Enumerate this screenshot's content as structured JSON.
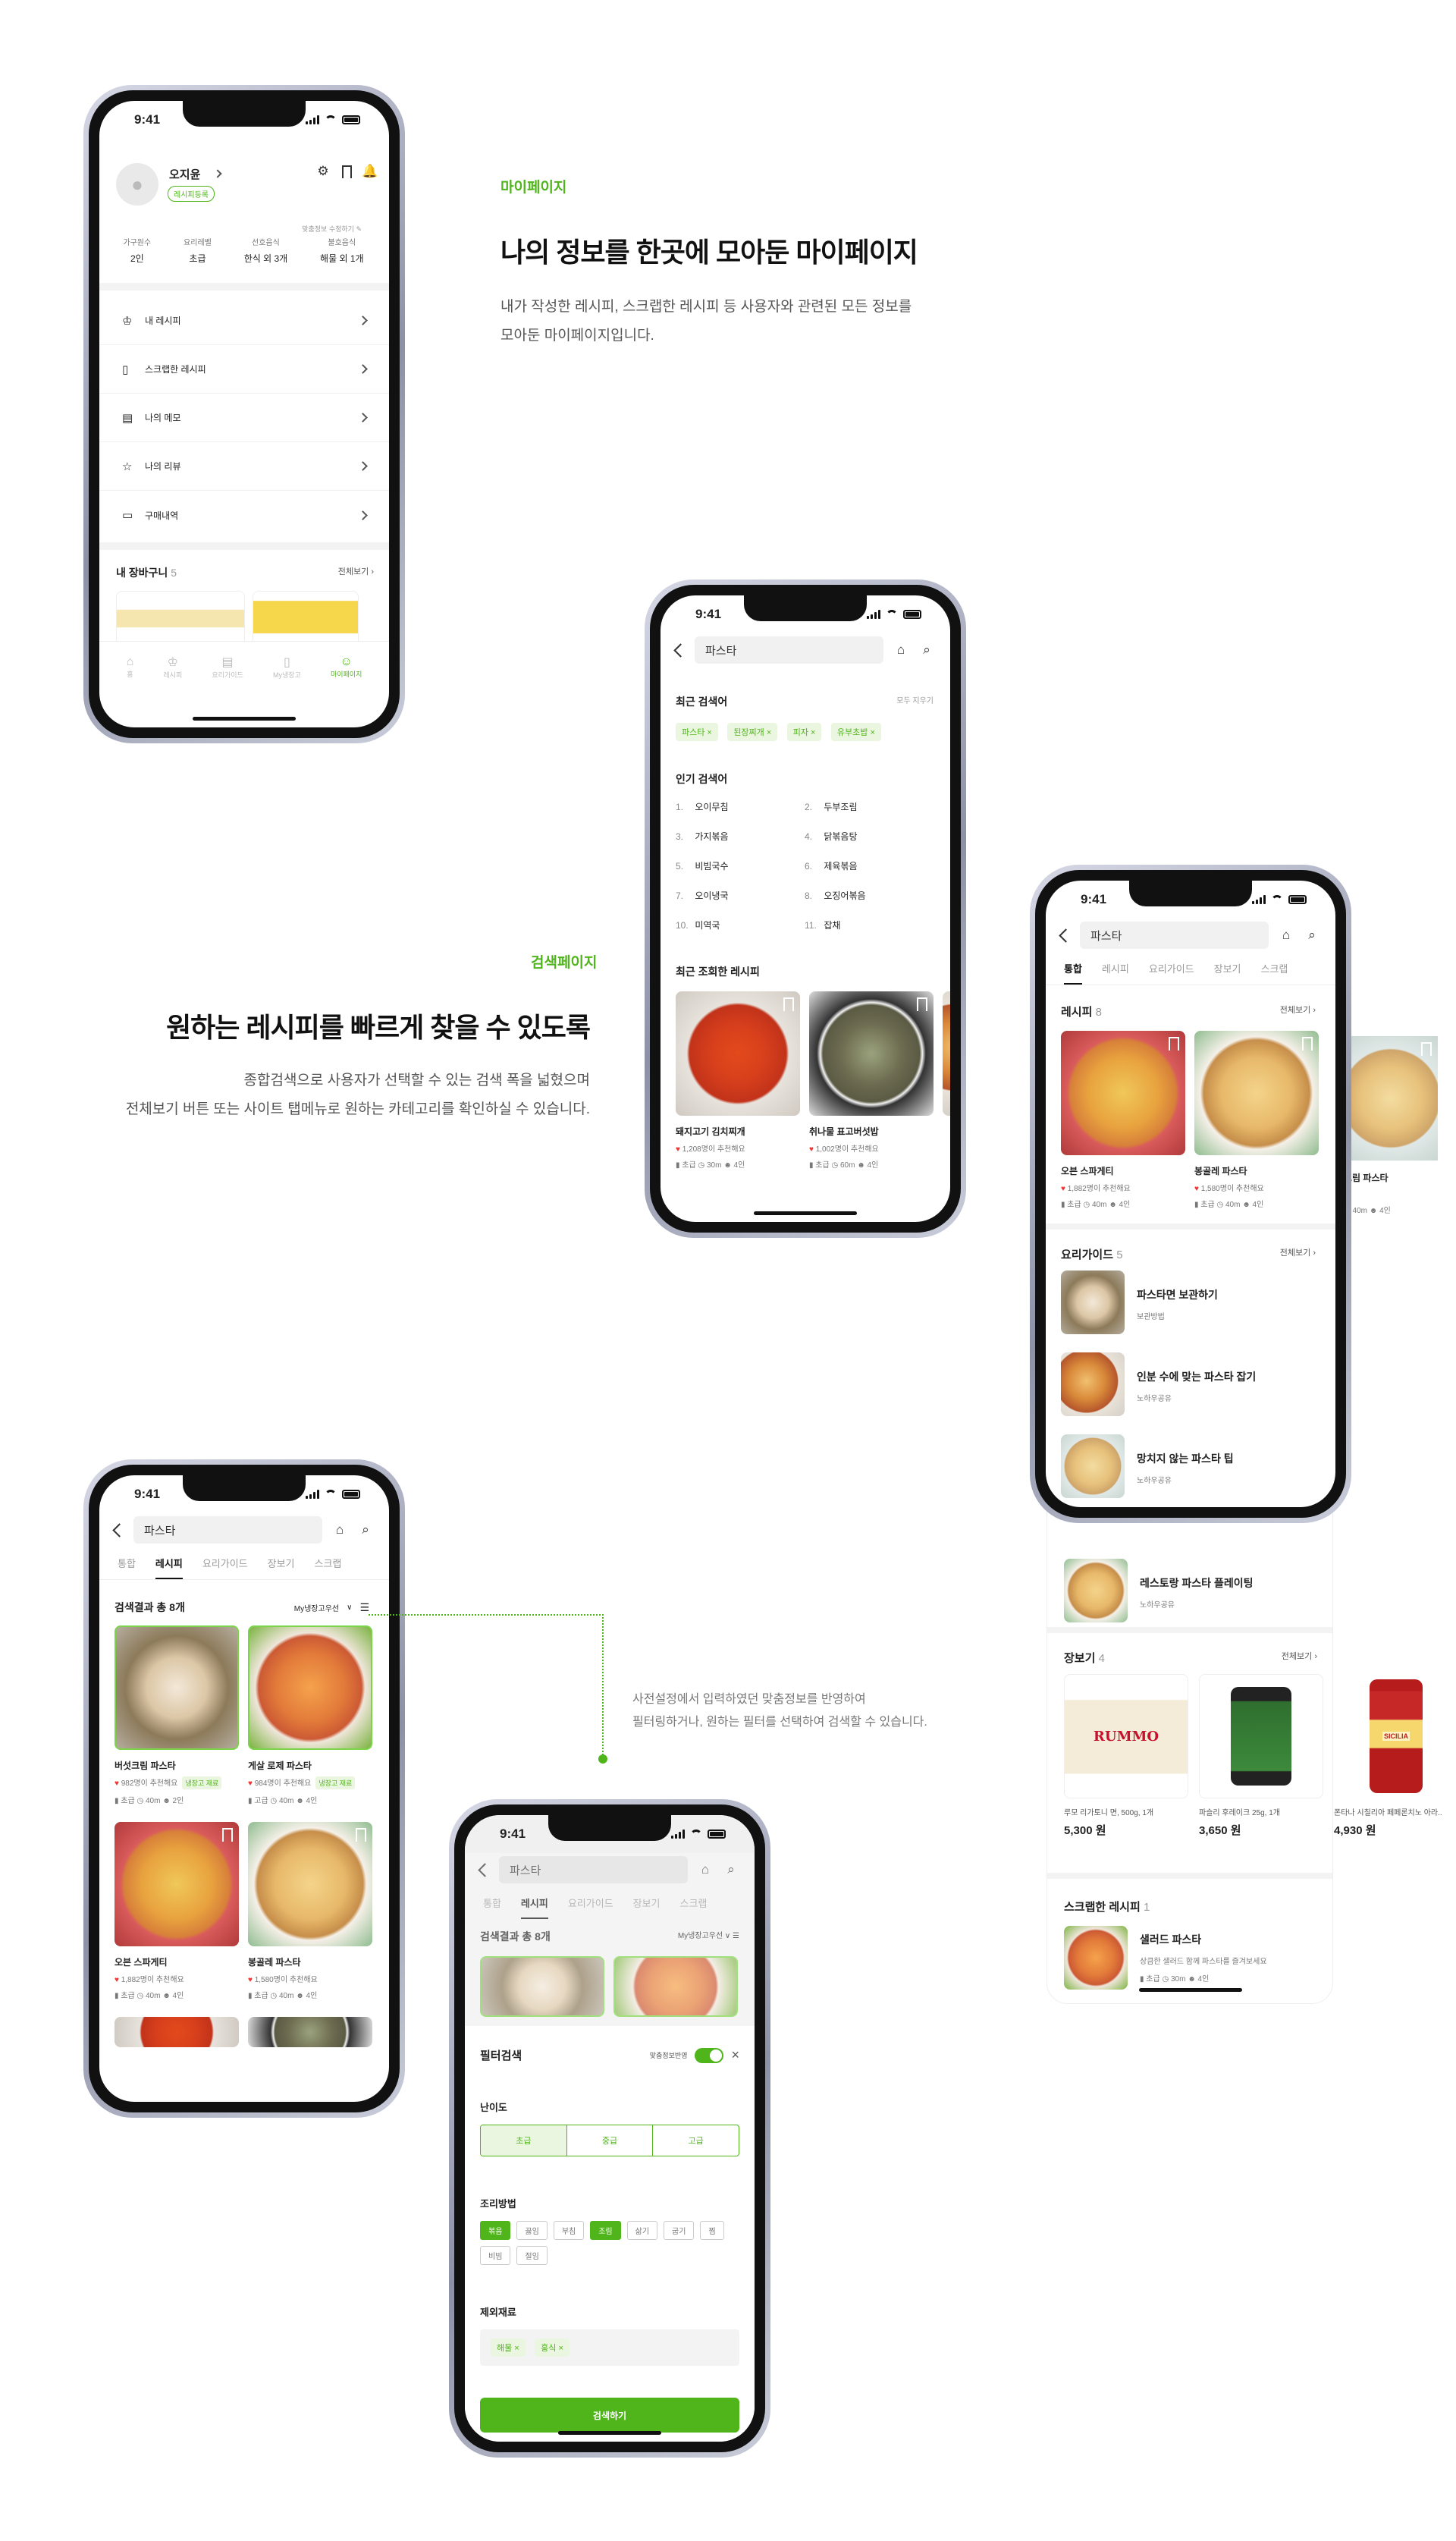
{
  "status_time": "9:41",
  "mypage": {
    "section_label": "마이페이지",
    "title": "나의 정보를 한곳에 모아둔 마이페이지",
    "desc1": "내가 작성한 레시피, 스크랩한 레시피 등 사용자와 관련된 모든 정보를",
    "desc2": "모아둔 마이페이지입니다.",
    "user_name": "오지윤",
    "user_badge": "레시피등록",
    "edit_link": "맞춤정보 수정하기",
    "stats": [
      {
        "label": "가구원수",
        "value": "2인"
      },
      {
        "label": "요리레벨",
        "value": "초급"
      },
      {
        "label": "선호음식",
        "value": "한식 외 3개"
      },
      {
        "label": "불호음식",
        "value": "해물 외 1개"
      }
    ],
    "menu": [
      "내 레시피",
      "스크랩한 레시피",
      "나의 메모",
      "나의 리뷰",
      "구매내역"
    ],
    "cart_label": "내 장바구니",
    "cart_count": "5",
    "view_all": "전체보기",
    "nav": [
      "홈",
      "레시피",
      "요리가이드",
      "My냉장고",
      "마이페이지"
    ]
  },
  "search": {
    "section_label": "검색페이지",
    "title": "원하는 레시피를 빠르게 찾을 수 있도록",
    "desc1": "종합검색으로 사용자가 선택할 수 있는 검색 폭을 넓혔으며",
    "desc2": "전체보기 버튼 또는 사이트 탭메뉴로 원하는 카테고리를 확인하실 수 있습니다.",
    "query": "파스타",
    "recent_label": "최근 검색어",
    "clear_all": "모두 지우기",
    "recent_chips": [
      "파스타",
      "된장찌개",
      "피자",
      "유부초밥"
    ],
    "popular_label": "인기 검색어",
    "popular": [
      [
        "1.",
        "오이무침"
      ],
      [
        "2.",
        "두부조림"
      ],
      [
        "3.",
        "가지볶음"
      ],
      [
        "4.",
        "닭볶음탕"
      ],
      [
        "5.",
        "비빔국수"
      ],
      [
        "6.",
        "제육볶음"
      ],
      [
        "7.",
        "오이냉국"
      ],
      [
        "8.",
        "오징어볶음"
      ],
      [
        "10.",
        "미역국"
      ],
      [
        "11.",
        "잡채"
      ]
    ],
    "viewed_label": "최근 조회한 레시피",
    "viewed": [
      {
        "title": "돼지고기 김치찌개",
        "likes": "1,208명이 추천해요",
        "level": "초급",
        "time": "30m",
        "serve": "4인"
      },
      {
        "title": "취나물 표고버섯밥",
        "likes": "1,002명이 추천해요",
        "level": "초급",
        "time": "60m",
        "serve": "4인"
      }
    ]
  },
  "integrated": {
    "tabs": [
      "통합",
      "레시피",
      "요리가이드",
      "장보기",
      "스크랩"
    ],
    "recipe_label": "레시피",
    "recipe_count": "8",
    "view_all": "전체보기",
    "recipes": [
      {
        "title": "오븐 스파게티",
        "likes": "1,882명이 추천해요",
        "level": "초급",
        "time": "40m",
        "serve": "4인"
      },
      {
        "title": "봉골레 파스타",
        "likes": "1,580명이 추천해요",
        "level": "초급",
        "time": "40m",
        "serve": "4인"
      },
      {
        "title": "크림 파스타",
        "level": "",
        "time": "40m",
        "serve": "4인"
      }
    ],
    "guide_label": "요리가이드",
    "guide_count": "5",
    "guides": [
      {
        "title": "파스타면 보관하기",
        "sub": "보관방법"
      },
      {
        "title": "인분 수에 맞는 파스타 잡기",
        "sub": "노하우공유"
      },
      {
        "title": "망치지 않는 파스타 팁",
        "sub": "노하우공유"
      },
      {
        "title": "레스토랑 파스타 플레이팅",
        "sub": "노하우공유"
      }
    ],
    "shop_label": "장보기",
    "shop_count": "4",
    "shop": [
      {
        "name": "루모 리가토니 면, 500g, 1개",
        "price": "5,300 원",
        "brand": "RUMMO"
      },
      {
        "name": "파슬리 후레이크 25g, 1개",
        "price": "3,650 원",
        "brand": ""
      },
      {
        "name": "폰타나 시칠리아 페페론치노 아라..",
        "price": "4,930 원",
        "brand": "SICILIA"
      }
    ],
    "scrap_label": "스크랩한 레시피",
    "scrap_count": "1",
    "scrap": {
      "title": "샐러드 파스타",
      "sub": "상큼한 샐러드 함께 파스타를 즐겨보세요",
      "level": "초급",
      "time": "30m",
      "serve": "4인"
    }
  },
  "results": {
    "tabs": [
      "통합",
      "레시피",
      "요리가이드",
      "장보기",
      "스크랩"
    ],
    "count_label": "검색결과 총 8개",
    "sort": "My냉장고우선",
    "items": [
      {
        "title": "버섯크림 파스타",
        "likes": "982명이 추천해요",
        "badge": "냉장고 재료",
        "level": "초급",
        "time": "40m",
        "serve": "2인"
      },
      {
        "title": "게살 로제 파스타",
        "likes": "984명이 추천해요",
        "badge": "냉장고 재료",
        "level": "고급",
        "time": "40m",
        "serve": "4인"
      },
      {
        "title": "오븐 스파게티",
        "likes": "1,882명이 추천해요",
        "badge": "",
        "level": "초급",
        "time": "40m",
        "serve": "4인"
      },
      {
        "title": "봉골레 파스타",
        "likes": "1,580명이 추천해요",
        "badge": "",
        "level": "초급",
        "time": "40m",
        "serve": "4인"
      }
    ],
    "annotation1": "사전설정에서 입력하였던 맞춤정보를 반영하여",
    "annotation2": "필터링하거나, 원하는 필터를 선택하여 검색할 수 있습니다."
  },
  "filter": {
    "title": "필터검색",
    "toggle_label": "맞춤정보반영",
    "difficulty_label": "난이도",
    "difficulty": [
      "초급",
      "중급",
      "고급"
    ],
    "method_label": "조리방법",
    "methods": [
      "볶음",
      "끓임",
      "부침",
      "조림",
      "삶기",
      "굽기",
      "찜",
      "비빔",
      "절임"
    ],
    "exclude_label": "제외재료",
    "exclude": [
      "해물",
      "홍식"
    ],
    "submit": "검색하기"
  }
}
